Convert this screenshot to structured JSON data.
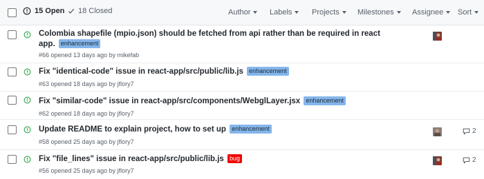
{
  "header": {
    "open_label": "15 Open",
    "closed_label": "18 Closed",
    "filters": {
      "author": "Author",
      "labels": "Labels",
      "projects": "Projects",
      "milestones": "Milestones",
      "assignee": "Assignee",
      "sort": "Sort"
    }
  },
  "issues": [
    {
      "title_line1": "Colombia shapefile (mpio.json) should be fetched from api rather than be required in react",
      "title_line2": "app.",
      "label": "enhancement",
      "meta": "#66 opened 13 days ago by mikefab"
    },
    {
      "title": "Fix \"identical-code\" issue in react-app/src/public/lib.js",
      "label": "enhancement",
      "meta": "#63 opened 18 days ago by jflory7"
    },
    {
      "title": "Fix \"similar-code\" issue in react-app/src/components/WebglLayer.jsx",
      "label": "enhancement",
      "meta": "#62 opened 18 days ago by jflory7"
    },
    {
      "title": "Update README to explain project, how to set up",
      "label": "enhancement",
      "meta": "#58 opened 25 days ago by jflory7",
      "comments": "2"
    },
    {
      "title": "Fix \"file_lines\" issue in react-app/src/public/lib.js",
      "label": "bug",
      "meta": "#56 opened 25 days ago by jflory7",
      "comments": "2"
    }
  ],
  "colors": {
    "open_icon": "#28a745",
    "label_enhancement": "#84b6eb",
    "label_bug": "#ee0701"
  },
  "icons": {
    "open_state": "issue-opened-icon",
    "closed_state": "check-icon",
    "comments": "comment-icon"
  }
}
